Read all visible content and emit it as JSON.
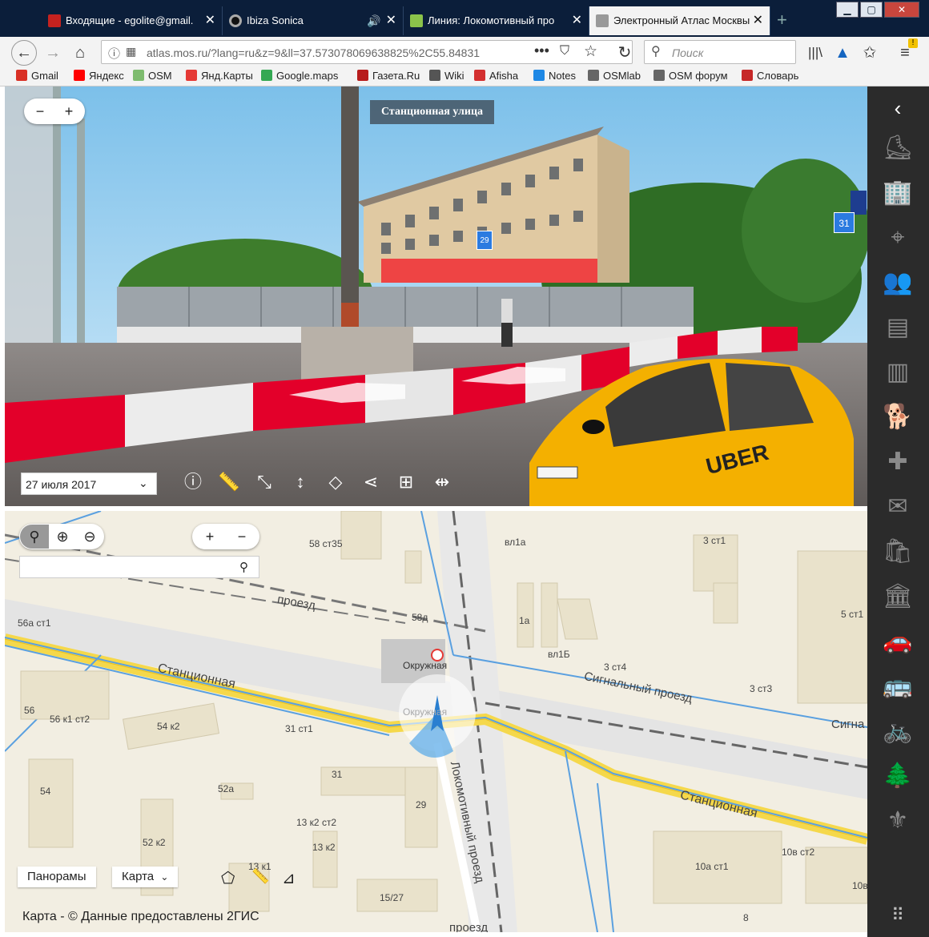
{
  "tabs": [
    {
      "title": "Входящие - egolite@gmail.",
      "color": "#c5221f"
    },
    {
      "title": "Ibiza Sonica",
      "color": "#222"
    },
    {
      "title": "Линия: Локомотивный про",
      "color": "#8bc34a"
    },
    {
      "title": "Электронный Атлас Москвы",
      "color": "#666"
    }
  ],
  "toolbar": {
    "url": "atlas.mos.ru/?lang=ru&z=9&ll=37.573078069638825%2C55.84831",
    "search_placeholder": "Поиск"
  },
  "bookmarks": [
    {
      "label": "Gmail",
      "color": "#d93025"
    },
    {
      "label": "Яндекс",
      "color": "#ff0000"
    },
    {
      "label": "OSM",
      "color": "#7ebc6f"
    },
    {
      "label": "Янд.Карты",
      "color": "#e53935"
    },
    {
      "label": "Google.maps",
      "color": "#34a853"
    },
    {
      "label": "Газета.Ru",
      "color": "#b71c1c"
    },
    {
      "label": "Wiki",
      "color": "#555"
    },
    {
      "label": "Afisha",
      "color": "#d32f2f"
    },
    {
      "label": "Notes",
      "color": "#1e88e5"
    },
    {
      "label": "OSMlab",
      "color": "#666"
    },
    {
      "label": "OSM форум",
      "color": "#666"
    },
    {
      "label": "Словарь",
      "color": "#c62828"
    }
  ],
  "panorama": {
    "street_name": "Станционная улица",
    "date": "27 июля 2017",
    "house_29": "29",
    "house_31": "31",
    "zoom_minus": "−",
    "zoom_plus": "+",
    "taxi_text": "UBER"
  },
  "map": {
    "zoom_plus": "+",
    "zoom_minus": "−",
    "metro_name": "Окружная",
    "metro_ghost": "Окружная",
    "street_stantsionnaya": "Станционная",
    "street_stantsionnaya2": "Станционная",
    "street_signalny": "Сигнальный проезд",
    "street_signalny_cut": "Сигна",
    "street_lokomotivny": "Локомотивный проезд",
    "street_proezd_top": "проезд",
    "street_bottom_cut": "проезд",
    "labels": [
      "58 ст35",
      "вл1а",
      "3 ст1",
      "56а ст1",
      "58д",
      "1а",
      "5 ст1",
      "вл1Б",
      "3 ст4",
      "3 ст3",
      "56",
      "56 к1 ст2",
      "54 к2",
      "31 ст1",
      "54",
      "52а",
      "31",
      "29",
      "13 к2 ст2",
      "52 к2",
      "13 к2",
      "13 к1",
      "15/27",
      "10а ст1",
      "10в ст2",
      "10в",
      "8"
    ],
    "btn_panoramas": "Панорамы",
    "btn_map": "Карта",
    "attribution": "Карта - © Данные предоставлены 2ГИС"
  }
}
